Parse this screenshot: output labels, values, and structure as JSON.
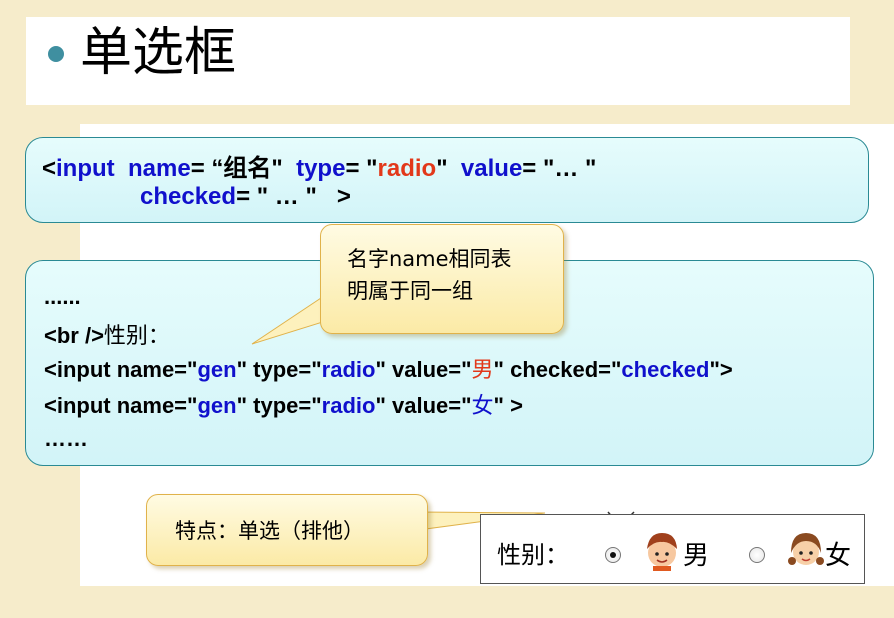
{
  "slide": {
    "title": "单选框",
    "syntax": {
      "p1": "<input  name= “组名\"  type= \"",
      "type_value": "radio",
      "p2": "\"  value= \"… \"",
      "p3": "checked= \" … \"   >"
    },
    "callout_name": [
      "名字name相同表",
      "明属于同一组"
    ],
    "example": {
      "dots_top": "......",
      "br_tag": "<br />",
      "br_label": "性别：",
      "lines": [
        {
          "pre": "<input name=\"",
          "name": "gen",
          "mid1": "\" type=\"",
          "type": "radio",
          "mid2": "\" value=\"",
          "value": "男",
          "mid3": "\" checked=\"",
          "checked": "checked",
          "end": "\">"
        },
        {
          "pre": "<input name=\"",
          "name": "gen",
          "mid1": "\" type=\"",
          "type": "radio",
          "mid2": "\" value=\"",
          "value": "女",
          "end": "\" >"
        }
      ],
      "dots_bottom": "……"
    },
    "callout_feature": "特点：单选（排他）",
    "demo": {
      "label": "性别：",
      "options": [
        {
          "text": "男",
          "checked": true
        },
        {
          "text": "女",
          "checked": false
        }
      ]
    },
    "colors": {
      "background": "#f6eccb",
      "keyword_blue": "#1010cc",
      "value_red": "#e2381a",
      "code_box_border": "#2a8a94",
      "callout_border": "#e0b24a"
    }
  }
}
